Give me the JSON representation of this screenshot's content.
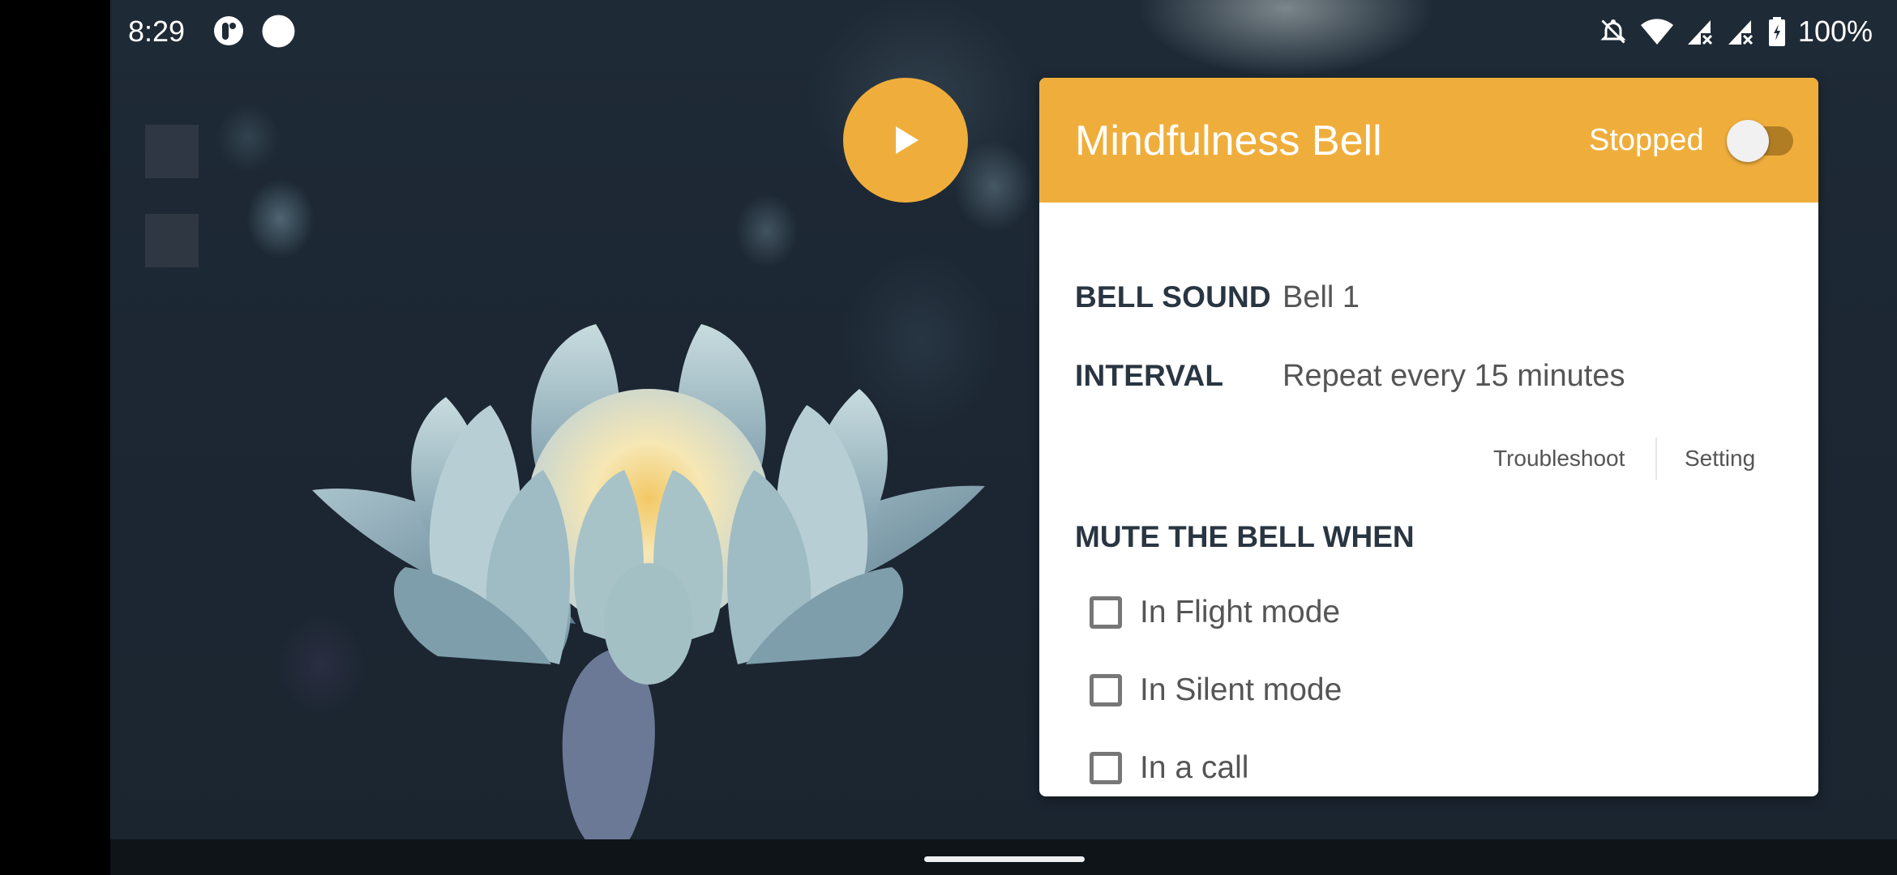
{
  "status_bar": {
    "time": "8:29",
    "left_icons": [
      "app-notification-icon",
      "circle-notification-icon"
    ],
    "right_icons": [
      "bell-off-icon",
      "wifi-icon",
      "signal-no-service-icon",
      "signal-no-service-icon",
      "battery-charging-icon"
    ],
    "battery_percent": "100%"
  },
  "play_button": {
    "icon": "play-icon"
  },
  "card": {
    "title": "Mindfulness Bell",
    "status_label": "Stopped",
    "toggle_on": false,
    "accent_color": "#efae3c",
    "rows": [
      {
        "label": "BELL SOUND",
        "value": "Bell 1"
      },
      {
        "label": "INTERVAL",
        "value": "Repeat every 15 minutes"
      }
    ],
    "links": {
      "troubleshoot": "Troubleshoot",
      "setting": "Setting"
    },
    "mute_section": {
      "title": "MUTE THE BELL WHEN",
      "options": [
        {
          "label": "In Flight mode",
          "checked": false
        },
        {
          "label": "In Silent mode",
          "checked": false
        },
        {
          "label": "In a call",
          "checked": false
        }
      ]
    }
  }
}
